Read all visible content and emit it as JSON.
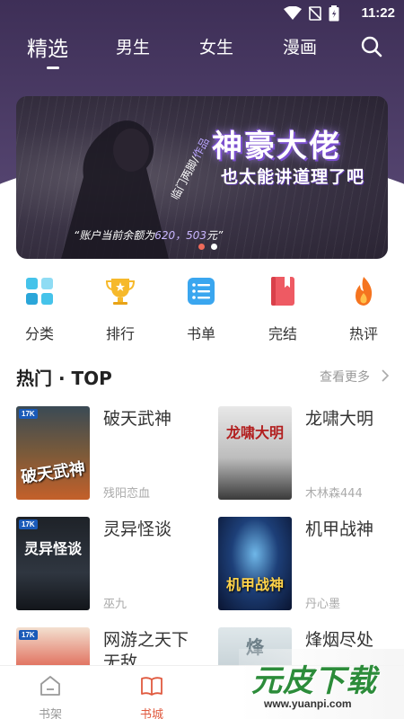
{
  "status": {
    "time": "11:22"
  },
  "nav": {
    "tabs": [
      {
        "label": "精选",
        "active": true
      },
      {
        "label": "男生"
      },
      {
        "label": "女生"
      },
      {
        "label": "漫画"
      }
    ],
    "search_icon": "search-icon"
  },
  "banner": {
    "title": "神豪大佬",
    "subtitle": "也太能讲道理了吧",
    "author_label": "临门两脚",
    "author_tag": "作品",
    "author_sep": "/",
    "balance_prefix": "“账户当前余额为",
    "balance_value": "620，503",
    "balance_suffix": "元”",
    "page_count": 2,
    "active_page": 1
  },
  "categories": [
    {
      "label": "分类",
      "icon": "grid-icon",
      "color": "#37b6e6"
    },
    {
      "label": "排行",
      "icon": "trophy-icon",
      "color": "#f6b92b"
    },
    {
      "label": "书单",
      "icon": "list-icon",
      "color": "#3aa6ef"
    },
    {
      "label": "完结",
      "icon": "book-icon",
      "color": "#ee5a63"
    },
    {
      "label": "热评",
      "icon": "flame-icon",
      "color": "#f5741f"
    }
  ],
  "section": {
    "title": "热门 · TOP",
    "more": "查看更多"
  },
  "books": [
    {
      "title": "破天武神",
      "author": "残阳恋血",
      "cover_text": "破天武神",
      "cover_logo": "17K"
    },
    {
      "title": "龙啸大明",
      "author": "木林森444",
      "cover_text": "龙啸大明",
      "cover_logo": ""
    },
    {
      "title": "灵异怪谈",
      "author": "巫九",
      "cover_text": "灵异怪谈",
      "cover_logo": "17K"
    },
    {
      "title": "机甲战神",
      "author": "丹心墨",
      "cover_text": "机甲战神",
      "cover_logo": ""
    },
    {
      "title": "网游之天下无敌",
      "author": "",
      "cover_text": "",
      "cover_logo": "17K"
    },
    {
      "title": "烽烟尽处",
      "author": "",
      "cover_text": "烽",
      "cover_logo": ""
    }
  ],
  "bottom_nav": [
    {
      "label": "书架",
      "icon": "bookshelf-icon",
      "active": false
    },
    {
      "label": "书城",
      "icon": "bookstore-icon",
      "active": true
    }
  ],
  "watermark": {
    "text": "元皮下载",
    "url": "www.yuanpi.com"
  },
  "colors": {
    "header": "#4a3b63",
    "accent": "#e05a3f"
  }
}
